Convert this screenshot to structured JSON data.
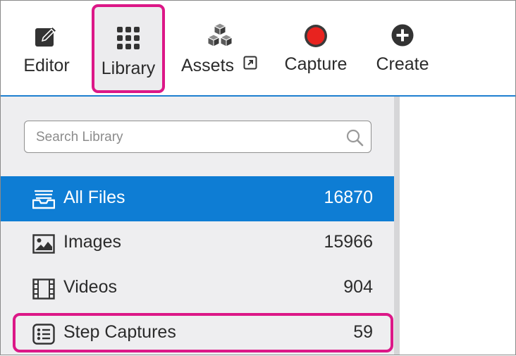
{
  "toolbar": {
    "items": [
      {
        "label": "Editor",
        "icon": "edit-icon"
      },
      {
        "label": "Library",
        "icon": "grid-icon"
      },
      {
        "label": "Assets",
        "icon": "cubes-icon",
        "badge_icon": "external-link-icon"
      },
      {
        "label": "Capture",
        "icon": "record-icon"
      },
      {
        "label": "Create",
        "icon": "plus-circle-icon"
      }
    ],
    "highlight_color": "#dc1787",
    "accent_color": "#1e7fd0"
  },
  "search": {
    "placeholder": "Search Library",
    "value": "",
    "icon": "search-icon"
  },
  "library_items": [
    {
      "label": "All Files",
      "count": "16870",
      "icon": "inbox-icon",
      "selected": true
    },
    {
      "label": "Images",
      "count": "15966",
      "icon": "image-icon",
      "selected": false
    },
    {
      "label": "Videos",
      "count": "904",
      "icon": "film-icon",
      "selected": false
    },
    {
      "label": "Step Captures",
      "count": "59",
      "icon": "checklist-icon",
      "selected": false
    }
  ],
  "colors": {
    "selected_row": "#0e7dd4",
    "record_red": "#e8231f",
    "sidebar_bg": "#eeeef0"
  }
}
